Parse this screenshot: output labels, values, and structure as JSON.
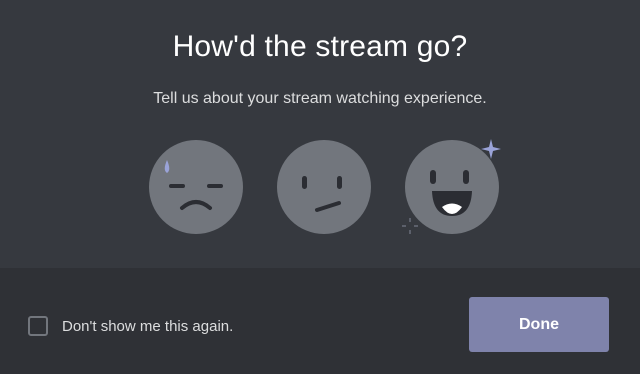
{
  "modal": {
    "title": "How'd the stream go?",
    "subtitle": "Tell us about your stream watching experience."
  },
  "ratings": [
    {
      "name": "sad-face",
      "icon": "sad-face-icon"
    },
    {
      "name": "neutral-face",
      "icon": "confused-face-icon"
    },
    {
      "name": "happy-face",
      "icon": "happy-face-icon"
    }
  ],
  "footer": {
    "checkbox_label": "Don't show me this again.",
    "checkbox_checked": false,
    "done_label": "Done"
  },
  "colors": {
    "modal_bg": "#36393f",
    "footer_bg": "#2f3136",
    "face_fill": "#72767d",
    "button_bg": "#7f83ab",
    "title_text": "#ffffff",
    "body_text": "#dcddde"
  }
}
